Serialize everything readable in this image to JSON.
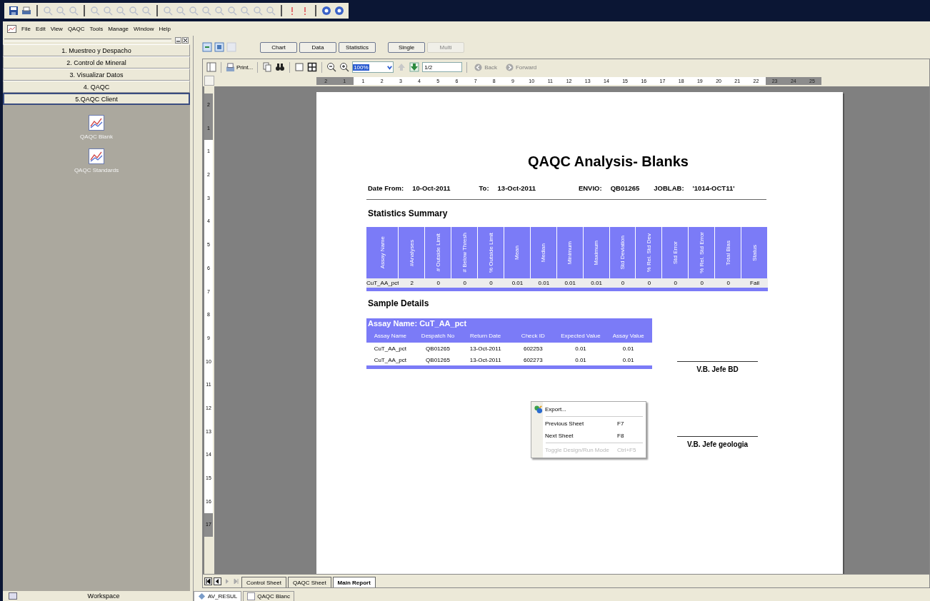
{
  "menu_bar": [
    "File",
    "Edit",
    "View",
    "QAQC",
    "Tools",
    "Manage",
    "Window",
    "Help"
  ],
  "sidebar": {
    "sections": [
      {
        "label": "1. Muestreo y Despacho",
        "selected": false
      },
      {
        "label": "2. Control de Mineral",
        "selected": false
      },
      {
        "label": "3.  Visualizar Datos",
        "selected": false
      },
      {
        "label": "4. QAQC",
        "selected": false
      },
      {
        "label": "5.QAQC Client",
        "selected": true
      }
    ],
    "items": [
      {
        "label": "QAQC Blank"
      },
      {
        "label": "QAQC Standards"
      }
    ],
    "footer": "Workspace"
  },
  "report_toolbar": {
    "view_buttons": [
      {
        "label": "Chart",
        "disabled": false
      },
      {
        "label": "Data",
        "disabled": false
      },
      {
        "label": "Statistics",
        "disabled": false
      }
    ],
    "mode_buttons": [
      {
        "label": "Single",
        "disabled": false
      },
      {
        "label": "Multi",
        "disabled": true
      }
    ],
    "print_label": "Print...",
    "zoom": "100%",
    "page": "1/2",
    "nav": [
      {
        "label": "Back",
        "kind": "back",
        "disabled": true
      },
      {
        "label": "Forward",
        "kind": "forward",
        "disabled": true
      }
    ]
  },
  "ruler": [
    {
      "text": "2",
      "shaded": true
    },
    {
      "text": "1",
      "shaded": true
    },
    {
      "text": "1",
      "shaded": false
    },
    {
      "text": "2",
      "shaded": false
    },
    {
      "text": "3",
      "shaded": false
    },
    {
      "text": "4",
      "shaded": false
    },
    {
      "text": "5",
      "shaded": false
    },
    {
      "text": "6",
      "shaded": false
    },
    {
      "text": "7",
      "shaded": false
    },
    {
      "text": "8",
      "shaded": false
    },
    {
      "text": "9",
      "shaded": false
    },
    {
      "text": "10",
      "shaded": false
    },
    {
      "text": "11",
      "shaded": false
    },
    {
      "text": "12",
      "shaded": false
    },
    {
      "text": "13",
      "shaded": false
    },
    {
      "text": "14",
      "shaded": false
    },
    {
      "text": "15",
      "shaded": false
    },
    {
      "text": "16",
      "shaded": false
    },
    {
      "text": "17",
      "shaded": false
    },
    {
      "text": "18",
      "shaded": false
    },
    {
      "text": "19",
      "shaded": false
    },
    {
      "text": "20",
      "shaded": false
    },
    {
      "text": "21",
      "shaded": false
    },
    {
      "text": "22",
      "shaded": false
    },
    {
      "text": "23",
      "shaded": true
    },
    {
      "text": "24",
      "shaded": true
    },
    {
      "text": "25",
      "shaded": true
    }
  ],
  "vertical_ruler": [
    {
      "text": "2",
      "shaded": true
    },
    {
      "text": "1",
      "shaded": true
    },
    {
      "text": "1",
      "shaded": false
    },
    {
      "text": "2",
      "shaded": false
    },
    {
      "text": "3",
      "shaded": false
    },
    {
      "text": "4",
      "shaded": false
    },
    {
      "text": "5",
      "shaded": false
    },
    {
      "text": "6",
      "shaded": false
    },
    {
      "text": "7",
      "shaded": false
    },
    {
      "text": "8",
      "shaded": false
    },
    {
      "text": "9",
      "shaded": false
    },
    {
      "text": "10",
      "shaded": false
    },
    {
      "text": "11",
      "shaded": false
    },
    {
      "text": "12",
      "shaded": false
    },
    {
      "text": "13",
      "shaded": false
    },
    {
      "text": "14",
      "shaded": false
    },
    {
      "text": "15",
      "shaded": false
    },
    {
      "text": "16",
      "shaded": false
    },
    {
      "text": "17",
      "shaded": true
    }
  ],
  "report": {
    "title": "QAQC Analysis- Blanks",
    "header": [
      {
        "label": "Date From:",
        "value": "10-Oct-2011"
      },
      {
        "label": "To:",
        "value": "13-Oct-2011"
      },
      {
        "label": "ENVIO:",
        "value": "QB01265"
      },
      {
        "label": "JOBLAB:",
        "value": "'1014-OCT11'"
      }
    ],
    "statistics_title": "Statistics Summary",
    "statistics": {
      "columns": [
        "Assay Name",
        "#Analyses",
        "# Outside Limit",
        "# Below Thresh",
        "% Outside Limit",
        "Mean",
        "Median",
        "Minimum",
        "Maximum",
        "Std Deviation",
        "% Rel. Std Dev",
        "Std Error",
        "% Rel. Std Error",
        "Total Bias",
        "Status"
      ],
      "rows": [
        [
          "CuT_AA_pct",
          "2",
          "0",
          "0",
          "0",
          "0.01",
          "0.01",
          "0.01",
          "0.01",
          "0",
          "0",
          "0",
          "0",
          "0",
          "Fail"
        ]
      ]
    },
    "details_title": "Sample Details",
    "details": {
      "group": "Assay Name: CuT_AA_pct",
      "columns": [
        "Assay Name",
        "Despatch No",
        "Return Date",
        "Check ID",
        "Expected Value",
        "Assay Value"
      ],
      "rows": [
        [
          "CuT_AA_pct",
          "QB01265",
          "13-Oct-2011",
          "602253",
          "0.01",
          "0.01"
        ],
        [
          "CuT_AA_pct",
          "QB01265",
          "13-Oct-2011",
          "602273",
          "0.01",
          "0.01"
        ]
      ]
    },
    "signatures": [
      "V.B. Jefe BD",
      "V.B. Jefe geologia"
    ]
  },
  "context_menu": [
    {
      "label": "Export...",
      "kind": "icon",
      "disabled": false
    },
    {
      "label": "Previous Sheet",
      "shortcut": "F7",
      "kind": "plain",
      "disabled": false
    },
    {
      "label": "Next Sheet",
      "shortcut": "F8",
      "kind": "plain",
      "disabled": false
    },
    {
      "label": "Toggle Design/Run Mode",
      "shortcut": "Ctrl+F5",
      "kind": "plain",
      "disabled": true
    }
  ],
  "sheet_tabs": [
    {
      "label": "Control Sheet",
      "selected": false
    },
    {
      "label": "QAQC Sheet",
      "selected": false
    },
    {
      "label": "Main Report",
      "selected": true
    }
  ],
  "window_tabs": [
    {
      "label": "AV_RESUL",
      "selected": true
    },
    {
      "label": "QAQC Blanc",
      "selected": false
    }
  ]
}
